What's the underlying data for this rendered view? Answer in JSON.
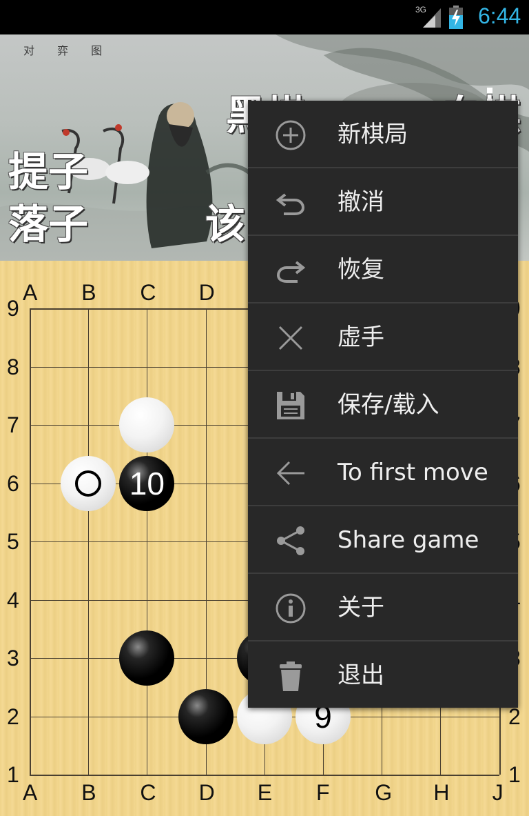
{
  "status_bar": {
    "network": "3G",
    "time": "6:44"
  },
  "header": {
    "calligraphy": "对 弈 图",
    "captured_label": "提子",
    "placed_label": "落子",
    "turn_label": "该",
    "black_label": "黑棋",
    "white_label": "白棋"
  },
  "board": {
    "columns": [
      "A",
      "B",
      "C",
      "D",
      "E",
      "F",
      "G",
      "H",
      "J"
    ],
    "rows": [
      "9",
      "8",
      "7",
      "6",
      "5",
      "4",
      "3",
      "2",
      "1"
    ],
    "stones": [
      {
        "color": "white",
        "col": "C",
        "row": "7"
      },
      {
        "color": "white",
        "col": "B",
        "row": "6",
        "last_move": true
      },
      {
        "color": "black",
        "col": "C",
        "row": "6",
        "label": "10"
      },
      {
        "color": "black",
        "col": "C",
        "row": "3"
      },
      {
        "color": "black",
        "col": "E",
        "row": "3"
      },
      {
        "color": "black",
        "col": "D",
        "row": "2"
      },
      {
        "color": "white",
        "col": "E",
        "row": "2"
      },
      {
        "color": "white",
        "col": "F",
        "row": "2",
        "label": "9"
      }
    ]
  },
  "menu": {
    "items": [
      {
        "name": "new-game",
        "label": "新棋局",
        "icon": "plus-circle-icon"
      },
      {
        "name": "undo",
        "label": "撤消",
        "icon": "undo-icon"
      },
      {
        "name": "redo",
        "label": "恢复",
        "icon": "redo-icon"
      },
      {
        "name": "pass",
        "label": "虚手",
        "icon": "close-icon"
      },
      {
        "name": "save-load",
        "label": "保存/载入",
        "icon": "save-icon"
      },
      {
        "name": "to-first-move",
        "label": "To first move",
        "icon": "arrow-left-icon"
      },
      {
        "name": "share-game",
        "label": "Share game",
        "icon": "share-icon"
      },
      {
        "name": "about",
        "label": "关于",
        "icon": "info-icon"
      },
      {
        "name": "exit",
        "label": "退出",
        "icon": "trash-icon"
      }
    ]
  }
}
